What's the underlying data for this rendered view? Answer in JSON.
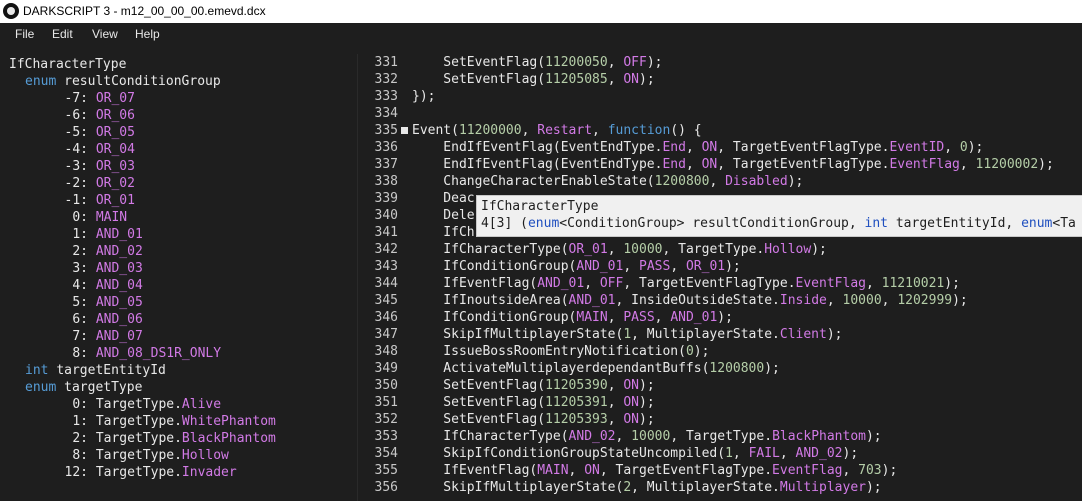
{
  "window": {
    "title": "DARKSCRIPT 3 - m12_00_00_00.emevd.dcx"
  },
  "menu": {
    "file": "File",
    "edit": "Edit",
    "view": "View",
    "help": "Help"
  },
  "doc": {
    "func_name": "IfCharacterType",
    "param1": {
      "type": "enum",
      "name": "resultConditionGroup",
      "values": [
        {
          "n": "-7:",
          "v": "OR_07"
        },
        {
          "n": "-6:",
          "v": "OR_06"
        },
        {
          "n": "-5:",
          "v": "OR_05"
        },
        {
          "n": "-4:",
          "v": "OR_04"
        },
        {
          "n": "-3:",
          "v": "OR_03"
        },
        {
          "n": "-2:",
          "v": "OR_02"
        },
        {
          "n": "-1:",
          "v": "OR_01"
        },
        {
          "n": "0:",
          "v": "MAIN"
        },
        {
          "n": "1:",
          "v": "AND_01"
        },
        {
          "n": "2:",
          "v": "AND_02"
        },
        {
          "n": "3:",
          "v": "AND_03"
        },
        {
          "n": "4:",
          "v": "AND_04"
        },
        {
          "n": "5:",
          "v": "AND_05"
        },
        {
          "n": "6:",
          "v": "AND_06"
        },
        {
          "n": "7:",
          "v": "AND_07"
        },
        {
          "n": "8:",
          "v": "AND_08_DS1R_ONLY"
        }
      ]
    },
    "param2": {
      "type": "int",
      "name": "targetEntityId"
    },
    "param3": {
      "type": "enum",
      "name": "targetType",
      "values": [
        {
          "n": "0:",
          "p": "TargetType.",
          "v": "Alive"
        },
        {
          "n": "1:",
          "p": "TargetType.",
          "v": "WhitePhantom"
        },
        {
          "n": "2:",
          "p": "TargetType.",
          "v": "BlackPhantom"
        },
        {
          "n": "8:",
          "p": "TargetType.",
          "v": "Hollow"
        },
        {
          "n": "12:",
          "p": "TargetType.",
          "v": "Invader"
        }
      ]
    }
  },
  "tooltip": {
    "line1": "IfCharacterType",
    "sig_index": "4[3] (",
    "sig_enum": "enum",
    "sig_generic": "<ConditionGroup> resultConditionGroup, ",
    "sig_int": "int",
    "sig_rest": " targetEntityId, ",
    "sig_enum2": "enum",
    "sig_tail": "<Ta"
  },
  "code_lines": [
    {
      "num": "331",
      "segs": [
        [
          "w",
          "    SetEventFlag("
        ],
        [
          "n",
          "11200050"
        ],
        [
          "w",
          ", "
        ],
        [
          "en",
          "OFF"
        ],
        [
          "w",
          ");"
        ]
      ]
    },
    {
      "num": "332",
      "segs": [
        [
          "w",
          "    SetEventFlag("
        ],
        [
          "n",
          "11205085"
        ],
        [
          "w",
          ", "
        ],
        [
          "en",
          "ON"
        ],
        [
          "w",
          ");"
        ]
      ]
    },
    {
      "num": "333",
      "segs": [
        [
          "w",
          "});"
        ]
      ]
    },
    {
      "num": "334",
      "segs": []
    },
    {
      "num": "335",
      "fold": true,
      "segs": [
        [
          "w",
          "Event("
        ],
        [
          "n",
          "11200000"
        ],
        [
          "w",
          ", "
        ],
        [
          "en",
          "Restart"
        ],
        [
          "w",
          ", "
        ],
        [
          "k",
          "function"
        ],
        [
          "w",
          "() {"
        ]
      ]
    },
    {
      "num": "336",
      "segs": [
        [
          "w",
          "    EndIfEventFlag(EventEndType."
        ],
        [
          "en",
          "End"
        ],
        [
          "w",
          ", "
        ],
        [
          "en",
          "ON"
        ],
        [
          "w",
          ", TargetEventFlagType."
        ],
        [
          "en",
          "EventID"
        ],
        [
          "w",
          ", "
        ],
        [
          "n",
          "0"
        ],
        [
          "w",
          ");"
        ]
      ]
    },
    {
      "num": "337",
      "segs": [
        [
          "w",
          "    EndIfEventFlag(EventEndType."
        ],
        [
          "en",
          "End"
        ],
        [
          "w",
          ", "
        ],
        [
          "en",
          "ON"
        ],
        [
          "w",
          ", TargetEventFlagType."
        ],
        [
          "en",
          "EventFlag"
        ],
        [
          "w",
          ", "
        ],
        [
          "n",
          "11200002"
        ],
        [
          "w",
          ");"
        ]
      ]
    },
    {
      "num": "338",
      "segs": [
        [
          "w",
          "    ChangeCharacterEnableState("
        ],
        [
          "n",
          "1200800"
        ],
        [
          "w",
          ", "
        ],
        [
          "en",
          "Disabled"
        ],
        [
          "w",
          ");"
        ]
      ]
    },
    {
      "num": "339",
      "segs": [
        [
          "w",
          "    Deac"
        ]
      ]
    },
    {
      "num": "340",
      "segs": [
        [
          "w",
          "    Dele"
        ]
      ]
    },
    {
      "num": "341",
      "segs": [
        [
          "w",
          "    IfCh"
        ]
      ]
    },
    {
      "num": "342",
      "segs": [
        [
          "w",
          "    IfCharacterType("
        ],
        [
          "en",
          "OR_01"
        ],
        [
          "w",
          ", "
        ],
        [
          "n",
          "10000"
        ],
        [
          "w",
          ", TargetType."
        ],
        [
          "en",
          "Hollow"
        ],
        [
          "w",
          ");"
        ]
      ]
    },
    {
      "num": "343",
      "segs": [
        [
          "w",
          "    IfConditionGroup("
        ],
        [
          "en",
          "AND_01"
        ],
        [
          "w",
          ", "
        ],
        [
          "en",
          "PASS"
        ],
        [
          "w",
          ", "
        ],
        [
          "en",
          "OR_01"
        ],
        [
          "w",
          ");"
        ]
      ]
    },
    {
      "num": "344",
      "segs": [
        [
          "w",
          "    IfEventFlag("
        ],
        [
          "en",
          "AND_01"
        ],
        [
          "w",
          ", "
        ],
        [
          "en",
          "OFF"
        ],
        [
          "w",
          ", TargetEventFlagType."
        ],
        [
          "en",
          "EventFlag"
        ],
        [
          "w",
          ", "
        ],
        [
          "n",
          "11210021"
        ],
        [
          "w",
          ");"
        ]
      ]
    },
    {
      "num": "345",
      "segs": [
        [
          "w",
          "    IfInoutsideArea("
        ],
        [
          "en",
          "AND_01"
        ],
        [
          "w",
          ", InsideOutsideState."
        ],
        [
          "en",
          "Inside"
        ],
        [
          "w",
          ", "
        ],
        [
          "n",
          "10000"
        ],
        [
          "w",
          ", "
        ],
        [
          "n",
          "1202999"
        ],
        [
          "w",
          ");"
        ]
      ]
    },
    {
      "num": "346",
      "segs": [
        [
          "w",
          "    IfConditionGroup("
        ],
        [
          "en",
          "MAIN"
        ],
        [
          "w",
          ", "
        ],
        [
          "en",
          "PASS"
        ],
        [
          "w",
          ", "
        ],
        [
          "en",
          "AND_01"
        ],
        [
          "w",
          ");"
        ]
      ]
    },
    {
      "num": "347",
      "segs": [
        [
          "w",
          "    SkipIfMultiplayerState("
        ],
        [
          "n",
          "1"
        ],
        [
          "w",
          ", MultiplayerState."
        ],
        [
          "en",
          "Client"
        ],
        [
          "w",
          ");"
        ]
      ]
    },
    {
      "num": "348",
      "segs": [
        [
          "w",
          "    IssueBossRoomEntryNotification("
        ],
        [
          "n",
          "0"
        ],
        [
          "w",
          ");"
        ]
      ]
    },
    {
      "num": "349",
      "segs": [
        [
          "w",
          "    ActivateMultiplayerdependantBuffs("
        ],
        [
          "n",
          "1200800"
        ],
        [
          "w",
          ");"
        ]
      ]
    },
    {
      "num": "350",
      "segs": [
        [
          "w",
          "    SetEventFlag("
        ],
        [
          "n",
          "11205390"
        ],
        [
          "w",
          ", "
        ],
        [
          "en",
          "ON"
        ],
        [
          "w",
          ");"
        ]
      ]
    },
    {
      "num": "351",
      "segs": [
        [
          "w",
          "    SetEventFlag("
        ],
        [
          "n",
          "11205391"
        ],
        [
          "w",
          ", "
        ],
        [
          "en",
          "ON"
        ],
        [
          "w",
          ");"
        ]
      ]
    },
    {
      "num": "352",
      "segs": [
        [
          "w",
          "    SetEventFlag("
        ],
        [
          "n",
          "11205393"
        ],
        [
          "w",
          ", "
        ],
        [
          "en",
          "ON"
        ],
        [
          "w",
          ");"
        ]
      ]
    },
    {
      "num": "353",
      "segs": [
        [
          "w",
          "    IfCharacterType("
        ],
        [
          "en",
          "AND_02"
        ],
        [
          "w",
          ", "
        ],
        [
          "n",
          "10000"
        ],
        [
          "w",
          ", TargetType."
        ],
        [
          "en",
          "BlackPhantom"
        ],
        [
          "w",
          ");"
        ]
      ]
    },
    {
      "num": "354",
      "segs": [
        [
          "w",
          "    SkipIfConditionGroupStateUncompiled("
        ],
        [
          "n",
          "1"
        ],
        [
          "w",
          ", "
        ],
        [
          "en",
          "FAIL"
        ],
        [
          "w",
          ", "
        ],
        [
          "en",
          "AND_02"
        ],
        [
          "w",
          ");"
        ]
      ]
    },
    {
      "num": "355",
      "segs": [
        [
          "w",
          "    IfEventFlag("
        ],
        [
          "en",
          "MAIN"
        ],
        [
          "w",
          ", "
        ],
        [
          "en",
          "ON"
        ],
        [
          "w",
          ", TargetEventFlagType."
        ],
        [
          "en",
          "EventFlag"
        ],
        [
          "w",
          ", "
        ],
        [
          "n",
          "703"
        ],
        [
          "w",
          ");"
        ]
      ]
    },
    {
      "num": "356",
      "segs": [
        [
          "w",
          "    SkipIfMultiplayerState("
        ],
        [
          "n",
          "2"
        ],
        [
          "w",
          ", MultiplayerState."
        ],
        [
          "en",
          "Multiplayer"
        ],
        [
          "w",
          ");"
        ]
      ]
    }
  ],
  "colors": {
    "enum_value": "#d27ae6",
    "keyword": "#569cd6",
    "number": "#b5cea8",
    "text": "#e8e8e8",
    "background": "#1e1e1e"
  }
}
